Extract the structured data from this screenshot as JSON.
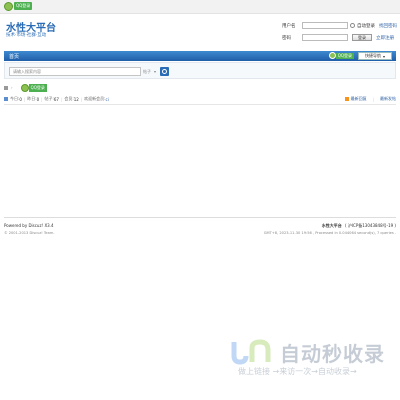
{
  "topbar": {
    "qq_label": "QQ登录"
  },
  "header": {
    "site_title": "水性大平台",
    "site_subtitle": "技术·市场·社群·互动"
  },
  "login": {
    "username_label": "用户名",
    "password_label": "密码",
    "remember_label": "自动登录",
    "forgot_label": "找回密码",
    "login_button": "登录",
    "register_label": "立即注册"
  },
  "navbar": {
    "home": "首页",
    "qq_label": "QQ登录",
    "quick_nav": "快捷导航"
  },
  "search": {
    "placeholder": "请输入搜索内容",
    "type_label": "帖子"
  },
  "crumb": {
    "separator": "›",
    "qq_label": "QQ登录"
  },
  "stats": {
    "today_label": "今日:",
    "today_value": "0",
    "yesterday_label": "昨日:",
    "yesterday_value": "0",
    "posts_label": "帖子:",
    "posts_value": "67",
    "members_label": "会员:",
    "members_value": "12",
    "newest_label": "欢迎新会员:",
    "newest_value": "ci"
  },
  "stats_links": {
    "latest_reply": "最新回复",
    "latest_post": "最新发帖"
  },
  "footer": {
    "powered": "Powered by Discuz! X3.4",
    "copyright": "© 2001-2013 Discuz! Team.",
    "site_name": "水性大平台",
    "icp": "( 沪ICP备13043848号-19 )",
    "gmt": "GMT+8, 2023-11-30 19:56 , Processed in 0.044064 second(s), 7 queries ."
  },
  "watermark": {
    "title": "自动秒收录",
    "slogan": "做上链接 →来访一次→自动收录→"
  },
  "colors": {
    "brand_blue": "#2a6cb5",
    "nav_bar": "#1f5ea8",
    "qq_green": "#4caf50"
  }
}
